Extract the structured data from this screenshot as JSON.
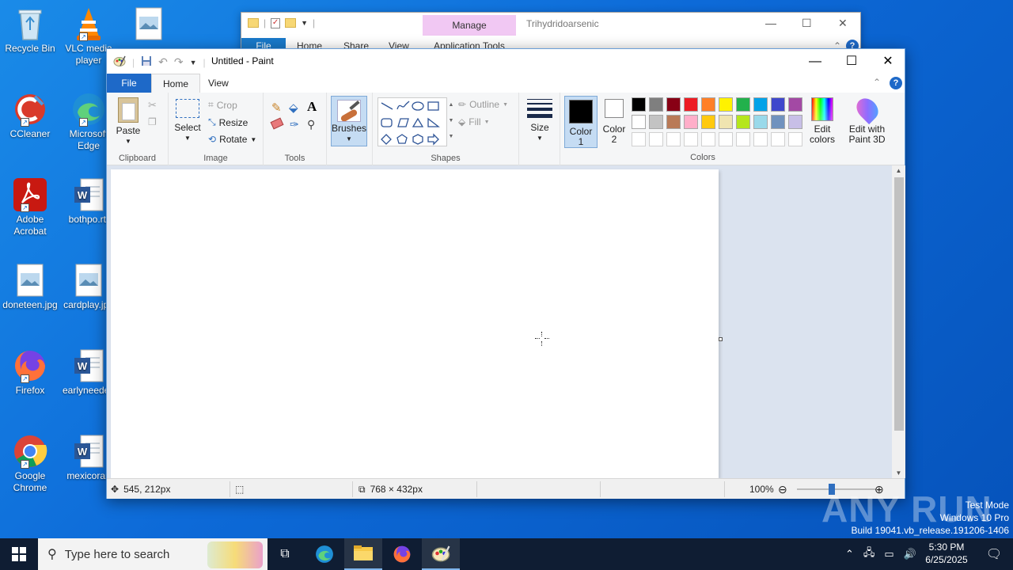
{
  "desktop": {
    "icons": [
      {
        "label": "Recycle Bin",
        "icon": "recycle-bin-icon"
      },
      {
        "label": "VLC media player",
        "icon": "vlc-icon"
      },
      {
        "label": "",
        "icon": "image-file-icon"
      },
      {
        "label": "CCleaner",
        "icon": "ccleaner-icon"
      },
      {
        "label": "Microsoft Edge",
        "icon": "edge-icon"
      },
      {
        "label": "Adobe Acrobat",
        "icon": "acrobat-icon"
      },
      {
        "label": "bothpo.rtf",
        "icon": "word-doc-icon"
      },
      {
        "label": "doneteen.jpg",
        "icon": "image-file-icon"
      },
      {
        "label": "cardplay.jpg",
        "icon": "image-file-icon"
      },
      {
        "label": "Firefox",
        "icon": "firefox-icon"
      },
      {
        "label": "earlyneeded",
        "icon": "word-doc-icon"
      },
      {
        "label": "Google Chrome",
        "icon": "chrome-icon"
      },
      {
        "label": "mexicoran",
        "icon": "word-doc-icon"
      }
    ]
  },
  "explorer": {
    "manage_label": "Manage",
    "title": "Trihydridoarsenic",
    "tabs": [
      "File",
      "Home",
      "Share",
      "View",
      "Application Tools"
    ]
  },
  "paint": {
    "title": "Untitled - Paint",
    "tabs": {
      "file": "File",
      "home": "Home",
      "view": "View"
    },
    "clipboard": {
      "paste": "Paste",
      "group": "Clipboard"
    },
    "image": {
      "select": "Select",
      "crop": "Crop",
      "resize": "Resize",
      "rotate": "Rotate",
      "group": "Image"
    },
    "tools": {
      "group": "Tools"
    },
    "brushes": {
      "label": "Brushes"
    },
    "shapes": {
      "outline": "Outline",
      "fill": "Fill",
      "group": "Shapes"
    },
    "size": {
      "label": "Size"
    },
    "colors": {
      "color1": "Color 1",
      "color1_line1": "Color",
      "color1_line2": "1",
      "color2_line1": "Color",
      "color2_line2": "2",
      "edit_line1": "Edit",
      "edit_line2": "colors",
      "paint3d_line1": "Edit with",
      "paint3d_line2": "Paint 3D",
      "group": "Colors",
      "palette_row1": [
        "#000000",
        "#7f7f7f",
        "#880015",
        "#ed1c24",
        "#ff7f27",
        "#fff200",
        "#22b14c",
        "#00a2e8",
        "#3f48cc",
        "#a349a4"
      ],
      "palette_row2": [
        "#ffffff",
        "#c3c3c3",
        "#b97a57",
        "#ffaec9",
        "#ffc90e",
        "#efe4b0",
        "#b5e61d",
        "#99d9ea",
        "#7092be",
        "#c8bfe7"
      ],
      "palette_row3": [
        "#ffffff",
        "#ffffff",
        "#ffffff",
        "#ffffff",
        "#ffffff",
        "#ffffff",
        "#ffffff",
        "#ffffff",
        "#ffffff",
        "#ffffff"
      ],
      "color1_value": "#000000",
      "color2_value": "#ffffff"
    },
    "status": {
      "cursor_pos": "545, 212px",
      "canvas_size": "768 × 432px",
      "zoom": "100%"
    }
  },
  "taskbar": {
    "search_placeholder": "Type here to search",
    "time": "5:30 PM",
    "date": "6/25/2025"
  },
  "watermark": {
    "line1": "Test Mode",
    "line2": "Windows 10 Pro",
    "line3": "Build 19041.vb_release.191206-1406",
    "brand": "ANY RUN"
  }
}
